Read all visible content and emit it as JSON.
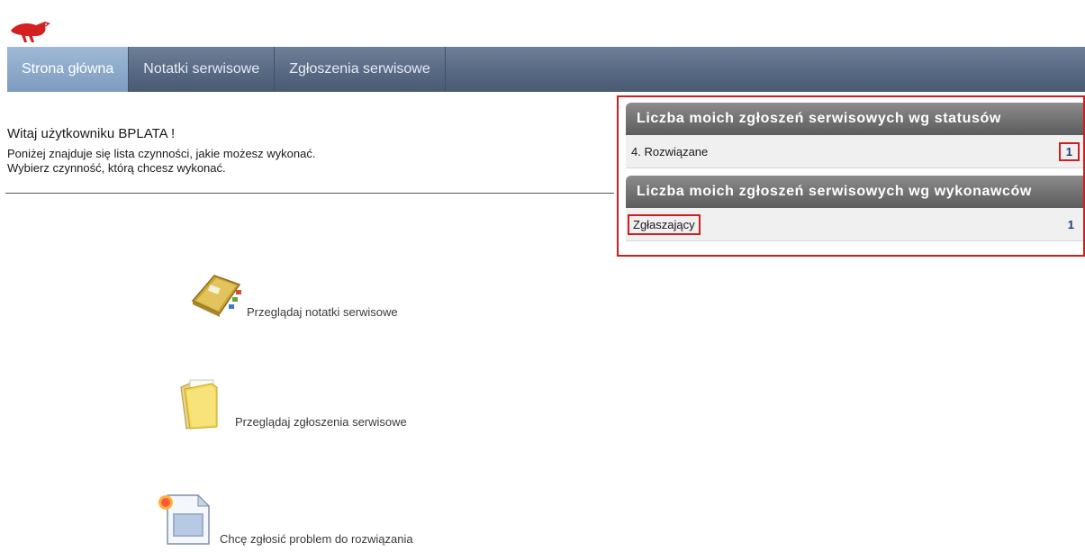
{
  "app": {
    "logo_icon": "red-bird-logo-icon"
  },
  "nav": {
    "tabs": [
      {
        "label": "Strona główna",
        "active": true
      },
      {
        "label": "Notatki serwisowe",
        "active": false
      },
      {
        "label": "Zgłoszenia serwisowe",
        "active": false
      }
    ]
  },
  "welcome": {
    "title": "Witaj użytkowniku BPLATA !",
    "line1": "Poniżej znajduje się lista czynności, jakie możesz wykonać.",
    "line2": "Wybierz czynność, którą chcesz wykonać."
  },
  "actions": [
    {
      "label": "Przeglądaj notatki serwisowe",
      "icon": "notebook-icon"
    },
    {
      "label": "Przeglądaj zgłoszenia serwisowe",
      "icon": "folder-icon"
    },
    {
      "label": "Chcę zgłosić problem do rozwiązania",
      "icon": "new-document-icon"
    }
  ],
  "panel": {
    "status_section": {
      "title": "Liczba moich zgłoszeń serwisowych wg statusów",
      "rows": [
        {
          "label": "4. Rozwiązane",
          "count": "1"
        }
      ]
    },
    "contractor_section": {
      "title": "Liczba moich zgłoszeń serwisowych wg wykonawców",
      "rows": [
        {
          "label": "Zgłaszający",
          "count": "1"
        }
      ]
    }
  },
  "colors": {
    "highlight_border": "#cc1f1f",
    "nav_active": "#8aa8c9",
    "nav_bg": "#5a6b85",
    "count_text": "#1e3a7a"
  }
}
